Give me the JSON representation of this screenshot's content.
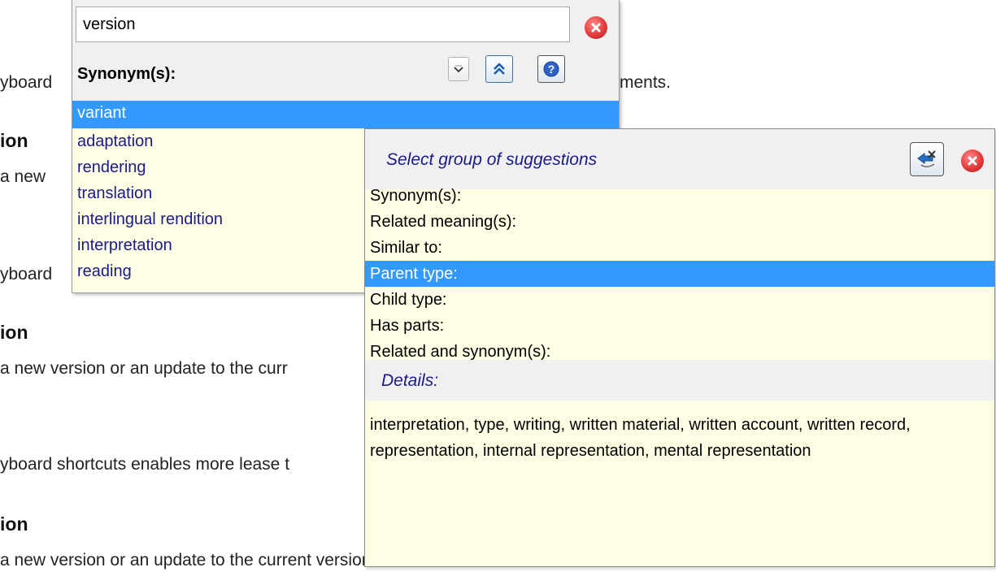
{
  "background": {
    "lines": [
      "yboard",
      "ments.",
      "ion",
      "a new",
      "yboard",
      "ion",
      "a new version or an update to the curr",
      "yboard shortcuts enables more lease t",
      "ion",
      "a new version or an update to the current version is available."
    ]
  },
  "synonym_popup": {
    "search_value": "version",
    "heading": "Synonym(s):",
    "items": [
      {
        "label": "variant"
      },
      {
        "label": "adaptation"
      },
      {
        "label": "rendering"
      },
      {
        "label": "translation"
      },
      {
        "label": "interlingual rendition"
      },
      {
        "label": "interpretation"
      },
      {
        "label": "reading"
      }
    ],
    "selected_index": 0
  },
  "suggestions_panel": {
    "title": "Select group of suggestions",
    "groups": [
      {
        "label": "Synonym(s):"
      },
      {
        "label": "Related meaning(s):"
      },
      {
        "label": "Similar to:"
      },
      {
        "label": "Parent type:"
      },
      {
        "label": "Child type:"
      },
      {
        "label": "Has parts:"
      },
      {
        "label": "Related and synonym(s):"
      }
    ],
    "selected_index": 3,
    "details_label": "Details:",
    "details_text": "interpretation, type, writing, written material, written account, written record, representation, internal representation, mental representation"
  },
  "icons": {
    "close": "close-circle-icon",
    "more": "chevron-down-icon",
    "collapse": "double-chevron-up-icon",
    "help": "help-icon",
    "back": "back-arrow-icon"
  },
  "colors": {
    "selection": "#3399ff",
    "list_text": "#1a1a8c",
    "popup_bg": "#fefee4",
    "header_bg": "#f0f0f0",
    "close_red": "#e23b3b"
  }
}
